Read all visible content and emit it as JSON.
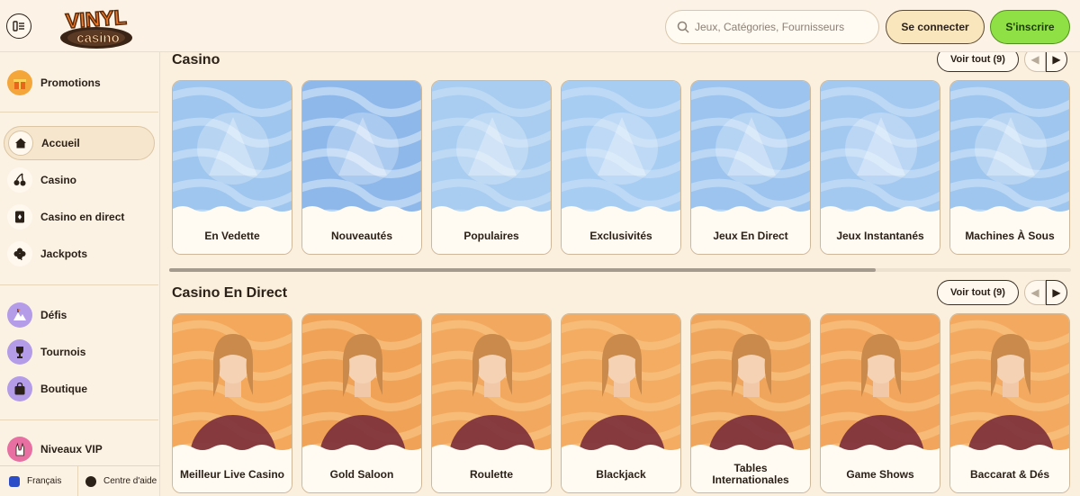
{
  "header": {
    "search_placeholder": "Jeux, Catégories, Fournisseurs",
    "login_label": "Se connecter",
    "signup_label": "S'inscrire",
    "logo_text_top": "VINYL",
    "logo_text_bottom": "casino"
  },
  "sidebar": {
    "promotions": "Promotions",
    "items": [
      {
        "label": "Accueil",
        "icon": "home-icon"
      },
      {
        "label": "Casino",
        "icon": "cherries-icon"
      },
      {
        "label": "Casino en direct",
        "icon": "live-cards-icon"
      },
      {
        "label": "Jackpots",
        "icon": "clover-icon"
      }
    ],
    "extras": [
      {
        "label": "Défis",
        "icon": "mountain-icon"
      },
      {
        "label": "Tournois",
        "icon": "trophy-icon"
      },
      {
        "label": "Boutique",
        "icon": "shopping-bag-icon"
      }
    ],
    "vip": "Niveaux VIP",
    "footer": {
      "language": "Français",
      "help": "Centre d'aide"
    }
  },
  "sections": [
    {
      "title": "Casino",
      "see_all": "Voir tout (9)",
      "cards": [
        {
          "label": "En Vedette",
          "bg": "#9fc6ee"
        },
        {
          "label": "Nouveautés",
          "bg": "#8fb8ea"
        },
        {
          "label": "Populaires",
          "bg": "#a9cdf0"
        },
        {
          "label": "Exclusivités",
          "bg": "#a7cdf2"
        },
        {
          "label": "Jeux En Direct",
          "bg": "#9cc4ee"
        },
        {
          "label": "Jeux Instantanés",
          "bg": "#a3c9f0"
        },
        {
          "label": "Machines À Sous",
          "bg": "#9fc6ee"
        }
      ]
    },
    {
      "title": "Casino En Direct",
      "see_all": "Voir tout (9)",
      "cards": [
        {
          "label": "Meilleur Live Casino",
          "bg": "#f3a85b"
        },
        {
          "label": "Gold Saloon",
          "bg": "#f0a257"
        },
        {
          "label": "Roulette",
          "bg": "#f2a95f"
        },
        {
          "label": "Blackjack",
          "bg": "#f3ac62"
        },
        {
          "label": "Tables Internationales",
          "bg": "#f0a55c"
        },
        {
          "label": "Game Shows",
          "bg": "#f2a65d"
        },
        {
          "label": "Baccarat & Dés",
          "bg": "#f3aa60"
        }
      ]
    }
  ],
  "colors": {
    "accent_green": "#8fe045",
    "accent_cream": "#f9e6bd",
    "logo_orange": "#f07a26",
    "casino_card_blue": "#9fc6ee",
    "live_card_orange": "#f3a85b"
  }
}
